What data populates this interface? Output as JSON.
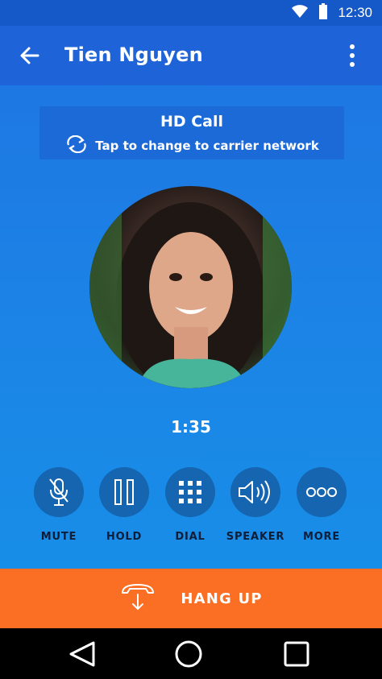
{
  "status_bar": {
    "time": "12:30",
    "icons": [
      "wifi-icon",
      "battery-icon"
    ]
  },
  "app_bar": {
    "title": "Tien Nguyen",
    "back_icon": "arrow-left-icon",
    "menu_icon": "more-vert-icon"
  },
  "hd_call": {
    "title": "HD Call",
    "subtitle": "Tap to change to carrier network",
    "icon": "sync-icon"
  },
  "call": {
    "duration": "1:35",
    "avatar": "contact-photo"
  },
  "controls": [
    {
      "label": "MUTE",
      "icon": "mic-off-icon"
    },
    {
      "label": "HOLD",
      "icon": "pause-icon"
    },
    {
      "label": "DIAL",
      "icon": "dialpad-icon"
    },
    {
      "label": "SPEAKER",
      "icon": "speaker-icon"
    },
    {
      "label": "MORE",
      "icon": "more-horiz-icon"
    }
  ],
  "hangup": {
    "label": "HANG UP",
    "icon": "hangup-icon"
  },
  "nav_bar": {
    "buttons": [
      "back-triangle-icon",
      "home-circle-icon",
      "recents-square-icon"
    ]
  },
  "colors": {
    "accent": "#1e64d8",
    "hangup": "#fb6f24",
    "control": "#1565b0"
  }
}
